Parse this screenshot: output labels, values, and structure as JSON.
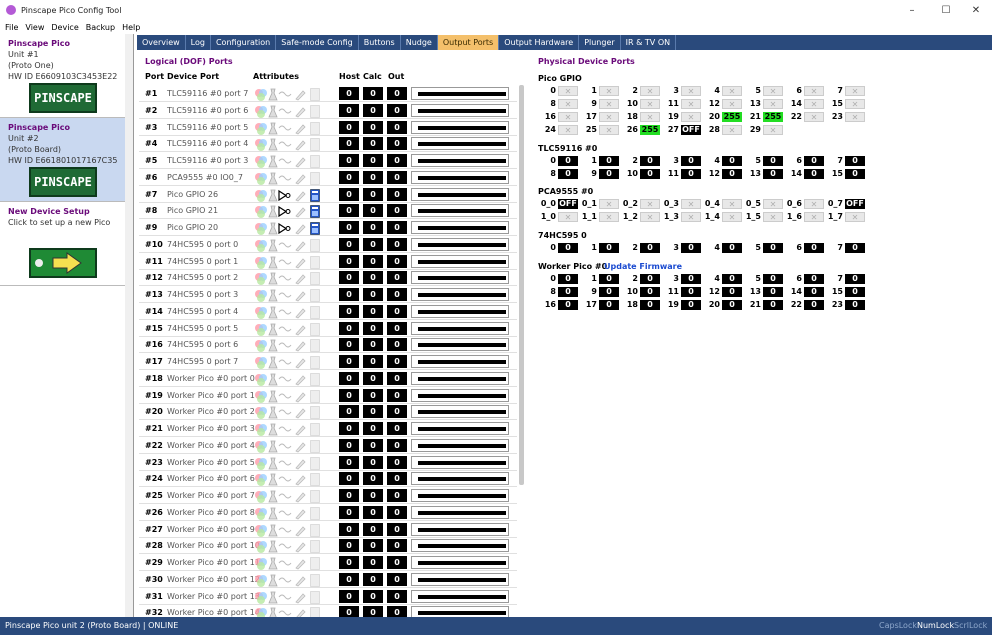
{
  "window": {
    "title": "Pinscape Pico Config Tool"
  },
  "menu": [
    "File",
    "View",
    "Device",
    "Backup",
    "Help"
  ],
  "devices": [
    {
      "name": "Pinscape Pico",
      "lines": [
        "Unit #1",
        "(Proto One)",
        "HW ID E6609103C3453E22"
      ],
      "logo": "PINSCAPE"
    },
    {
      "name": "Pinscape Pico",
      "lines": [
        "Unit #2",
        "(Proto Board)",
        "HW ID E661801017167C35"
      ],
      "logo": "PINSCAPE"
    },
    {
      "name": "New Device Setup",
      "lines": [
        "Click to set up a new Pico"
      ],
      "logo": ""
    }
  ],
  "tabs": [
    "Overview",
    "Log",
    "Configuration",
    "Safe-mode Config",
    "Buttons",
    "Nudge",
    "Output Ports",
    "Output Hardware",
    "Plunger",
    "IR & TV ON"
  ],
  "active_tab": "Output Ports",
  "logical": {
    "header": "Logical (DOF) Ports",
    "columns": {
      "port": "Port",
      "device": "Device Port",
      "attrs": "Attributes",
      "host": "Host",
      "calc": "Calc",
      "out": "Out"
    },
    "rows": [
      {
        "id": "#1",
        "dev": "TLC59116 #0 port 7",
        "host": "0",
        "calc": "0",
        "out": "0"
      },
      {
        "id": "#2",
        "dev": "TLC59116 #0 port 6",
        "host": "0",
        "calc": "0",
        "out": "0"
      },
      {
        "id": "#3",
        "dev": "TLC59116 #0 port 5",
        "host": "0",
        "calc": "0",
        "out": "0"
      },
      {
        "id": "#4",
        "dev": "TLC59116 #0 port 4",
        "host": "0",
        "calc": "0",
        "out": "0"
      },
      {
        "id": "#5",
        "dev": "TLC59116 #0 port 3",
        "host": "0",
        "calc": "0",
        "out": "0"
      },
      {
        "id": "#6",
        "dev": "PCA9555 #0 IO0_7",
        "host": "0",
        "calc": "0",
        "out": "0"
      },
      {
        "id": "#7",
        "dev": "Pico GPIO 26",
        "host": "0",
        "calc": "0",
        "out": "0"
      },
      {
        "id": "#8",
        "dev": "Pico GPIO 21",
        "host": "0",
        "calc": "0",
        "out": "0"
      },
      {
        "id": "#9",
        "dev": "Pico GPIO 20",
        "host": "0",
        "calc": "0",
        "out": "0"
      },
      {
        "id": "#10",
        "dev": "74HC595 0 port 0",
        "host": "0",
        "calc": "0",
        "out": "0"
      },
      {
        "id": "#11",
        "dev": "74HC595 0 port 1",
        "host": "0",
        "calc": "0",
        "out": "0"
      },
      {
        "id": "#12",
        "dev": "74HC595 0 port 2",
        "host": "0",
        "calc": "0",
        "out": "0"
      },
      {
        "id": "#13",
        "dev": "74HC595 0 port 3",
        "host": "0",
        "calc": "0",
        "out": "0"
      },
      {
        "id": "#14",
        "dev": "74HC595 0 port 4",
        "host": "0",
        "calc": "0",
        "out": "0"
      },
      {
        "id": "#15",
        "dev": "74HC595 0 port 5",
        "host": "0",
        "calc": "0",
        "out": "0"
      },
      {
        "id": "#16",
        "dev": "74HC595 0 port 6",
        "host": "0",
        "calc": "0",
        "out": "0"
      },
      {
        "id": "#17",
        "dev": "74HC595 0 port 7",
        "host": "0",
        "calc": "0",
        "out": "0"
      },
      {
        "id": "#18",
        "dev": "Worker Pico #0 port 0",
        "host": "0",
        "calc": "0",
        "out": "0"
      },
      {
        "id": "#19",
        "dev": "Worker Pico #0 port 1",
        "host": "0",
        "calc": "0",
        "out": "0"
      },
      {
        "id": "#20",
        "dev": "Worker Pico #0 port 2",
        "host": "0",
        "calc": "0",
        "out": "0"
      },
      {
        "id": "#21",
        "dev": "Worker Pico #0 port 3",
        "host": "0",
        "calc": "0",
        "out": "0"
      },
      {
        "id": "#22",
        "dev": "Worker Pico #0 port 4",
        "host": "0",
        "calc": "0",
        "out": "0"
      },
      {
        "id": "#23",
        "dev": "Worker Pico #0 port 5",
        "host": "0",
        "calc": "0",
        "out": "0"
      },
      {
        "id": "#24",
        "dev": "Worker Pico #0 port 6",
        "host": "0",
        "calc": "0",
        "out": "0"
      },
      {
        "id": "#25",
        "dev": "Worker Pico #0 port 7",
        "host": "0",
        "calc": "0",
        "out": "0"
      },
      {
        "id": "#26",
        "dev": "Worker Pico #0 port 8",
        "host": "0",
        "calc": "0",
        "out": "0"
      },
      {
        "id": "#27",
        "dev": "Worker Pico #0 port 9",
        "host": "0",
        "calc": "0",
        "out": "0"
      },
      {
        "id": "#28",
        "dev": "Worker Pico #0 port 10",
        "host": "0",
        "calc": "0",
        "out": "0"
      },
      {
        "id": "#29",
        "dev": "Worker Pico #0 port 11",
        "host": "0",
        "calc": "0",
        "out": "0"
      },
      {
        "id": "#30",
        "dev": "Worker Pico #0 port 12",
        "host": "0",
        "calc": "0",
        "out": "0"
      },
      {
        "id": "#31",
        "dev": "Worker Pico #0 port 13",
        "host": "0",
        "calc": "0",
        "out": "0"
      },
      {
        "id": "#32",
        "dev": "Worker Pico #0 port 14",
        "host": "0",
        "calc": "0",
        "out": "0"
      }
    ]
  },
  "physical": {
    "header": "Physical Device Ports",
    "sections": [
      {
        "title": "Pico GPIO",
        "cols": 8,
        "pins": [
          {
            "n": "0",
            "v": "",
            "s": "x"
          },
          {
            "n": "1",
            "v": "",
            "s": "x"
          },
          {
            "n": "2",
            "v": "",
            "s": "x"
          },
          {
            "n": "3",
            "v": "",
            "s": "x"
          },
          {
            "n": "4",
            "v": "",
            "s": "x"
          },
          {
            "n": "5",
            "v": "",
            "s": "x"
          },
          {
            "n": "6",
            "v": "",
            "s": "x"
          },
          {
            "n": "7",
            "v": "",
            "s": "x"
          },
          {
            "n": "8",
            "v": "",
            "s": "x"
          },
          {
            "n": "9",
            "v": "",
            "s": "x"
          },
          {
            "n": "10",
            "v": "",
            "s": "x"
          },
          {
            "n": "11",
            "v": "",
            "s": "x"
          },
          {
            "n": "12",
            "v": "",
            "s": "x"
          },
          {
            "n": "13",
            "v": "",
            "s": "x"
          },
          {
            "n": "14",
            "v": "",
            "s": "x"
          },
          {
            "n": "15",
            "v": "",
            "s": "x"
          },
          {
            "n": "16",
            "v": "",
            "s": "x"
          },
          {
            "n": "17",
            "v": "",
            "s": "x"
          },
          {
            "n": "18",
            "v": "",
            "s": "x"
          },
          {
            "n": "19",
            "v": "",
            "s": "x"
          },
          {
            "n": "20",
            "v": "255",
            "s": "g"
          },
          {
            "n": "21",
            "v": "255",
            "s": "g"
          },
          {
            "n": "22",
            "v": "",
            "s": "x"
          },
          {
            "n": "23",
            "v": "",
            "s": "x"
          },
          {
            "n": "24",
            "v": "",
            "s": "x"
          },
          {
            "n": "25",
            "v": "",
            "s": "x"
          },
          {
            "n": "26",
            "v": "255",
            "s": "g"
          },
          {
            "n": "27",
            "v": "OFF",
            "s": "b"
          },
          {
            "n": "28",
            "v": "",
            "s": "x"
          },
          {
            "n": "29",
            "v": "",
            "s": "x"
          }
        ]
      },
      {
        "title": "TLC59116 #0",
        "cols": 8,
        "pins": [
          {
            "n": "0",
            "v": "0",
            "s": "b"
          },
          {
            "n": "1",
            "v": "0",
            "s": "b"
          },
          {
            "n": "2",
            "v": "0",
            "s": "b"
          },
          {
            "n": "3",
            "v": "0",
            "s": "b"
          },
          {
            "n": "4",
            "v": "0",
            "s": "b"
          },
          {
            "n": "5",
            "v": "0",
            "s": "b"
          },
          {
            "n": "6",
            "v": "0",
            "s": "b"
          },
          {
            "n": "7",
            "v": "0",
            "s": "b"
          },
          {
            "n": "8",
            "v": "0",
            "s": "b"
          },
          {
            "n": "9",
            "v": "0",
            "s": "b"
          },
          {
            "n": "10",
            "v": "0",
            "s": "b"
          },
          {
            "n": "11",
            "v": "0",
            "s": "b"
          },
          {
            "n": "12",
            "v": "0",
            "s": "b"
          },
          {
            "n": "13",
            "v": "0",
            "s": "b"
          },
          {
            "n": "14",
            "v": "0",
            "s": "b"
          },
          {
            "n": "15",
            "v": "0",
            "s": "b"
          }
        ]
      },
      {
        "title": "PCA9555 #0",
        "cols": 8,
        "pins": [
          {
            "n": "0_0",
            "v": "OFF",
            "s": "b"
          },
          {
            "n": "0_1",
            "v": "",
            "s": "x"
          },
          {
            "n": "0_2",
            "v": "",
            "s": "x"
          },
          {
            "n": "0_3",
            "v": "",
            "s": "x"
          },
          {
            "n": "0_4",
            "v": "",
            "s": "x"
          },
          {
            "n": "0_5",
            "v": "",
            "s": "x"
          },
          {
            "n": "0_6",
            "v": "",
            "s": "x"
          },
          {
            "n": "0_7",
            "v": "OFF",
            "s": "b"
          },
          {
            "n": "1_0",
            "v": "",
            "s": "x"
          },
          {
            "n": "1_1",
            "v": "",
            "s": "x"
          },
          {
            "n": "1_2",
            "v": "",
            "s": "x"
          },
          {
            "n": "1_3",
            "v": "",
            "s": "x"
          },
          {
            "n": "1_4",
            "v": "",
            "s": "x"
          },
          {
            "n": "1_5",
            "v": "",
            "s": "x"
          },
          {
            "n": "1_6",
            "v": "",
            "s": "x"
          },
          {
            "n": "1_7",
            "v": "",
            "s": "x"
          }
        ]
      },
      {
        "title": "74HC595 0",
        "cols": 8,
        "pins": [
          {
            "n": "0",
            "v": "0",
            "s": "b"
          },
          {
            "n": "1",
            "v": "0",
            "s": "b"
          },
          {
            "n": "2",
            "v": "0",
            "s": "b"
          },
          {
            "n": "3",
            "v": "0",
            "s": "b"
          },
          {
            "n": "4",
            "v": "0",
            "s": "b"
          },
          {
            "n": "5",
            "v": "0",
            "s": "b"
          },
          {
            "n": "6",
            "v": "0",
            "s": "b"
          },
          {
            "n": "7",
            "v": "0",
            "s": "b"
          }
        ]
      },
      {
        "title": "Worker Pico #0",
        "link": "Update Firmware",
        "cols": 8,
        "pins": [
          {
            "n": "0",
            "v": "0",
            "s": "b"
          },
          {
            "n": "1",
            "v": "0",
            "s": "b"
          },
          {
            "n": "2",
            "v": "0",
            "s": "b"
          },
          {
            "n": "3",
            "v": "0",
            "s": "b"
          },
          {
            "n": "4",
            "v": "0",
            "s": "b"
          },
          {
            "n": "5",
            "v": "0",
            "s": "b"
          },
          {
            "n": "6",
            "v": "0",
            "s": "b"
          },
          {
            "n": "7",
            "v": "0",
            "s": "b"
          },
          {
            "n": "8",
            "v": "0",
            "s": "b"
          },
          {
            "n": "9",
            "v": "0",
            "s": "b"
          },
          {
            "n": "10",
            "v": "0",
            "s": "b"
          },
          {
            "n": "11",
            "v": "0",
            "s": "b"
          },
          {
            "n": "12",
            "v": "0",
            "s": "b"
          },
          {
            "n": "13",
            "v": "0",
            "s": "b"
          },
          {
            "n": "14",
            "v": "0",
            "s": "b"
          },
          {
            "n": "15",
            "v": "0",
            "s": "b"
          },
          {
            "n": "16",
            "v": "0",
            "s": "b"
          },
          {
            "n": "17",
            "v": "0",
            "s": "b"
          },
          {
            "n": "18",
            "v": "0",
            "s": "b"
          },
          {
            "n": "19",
            "v": "0",
            "s": "b"
          },
          {
            "n": "20",
            "v": "0",
            "s": "b"
          },
          {
            "n": "21",
            "v": "0",
            "s": "b"
          },
          {
            "n": "22",
            "v": "0",
            "s": "b"
          },
          {
            "n": "23",
            "v": "0",
            "s": "b"
          }
        ]
      }
    ]
  },
  "status": {
    "text": "Pinscape Pico unit 2 (Proto Board) | ONLINE",
    "caps": "CapsLock",
    "num": "NumLock",
    "scrl": "ScrlLock"
  },
  "colors": {
    "accent": "#2a4a7c",
    "active_tab": "#f4c06b",
    "device_name": "#6a0a7a",
    "on": "#22dd22"
  }
}
